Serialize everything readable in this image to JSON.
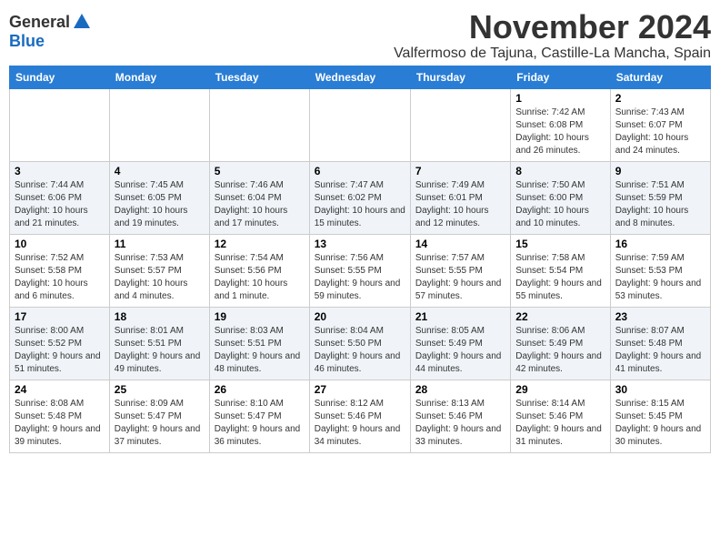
{
  "header": {
    "logo_general": "General",
    "logo_blue": "Blue",
    "month_title": "November 2024",
    "subtitle": "Valfermoso de Tajuna, Castille-La Mancha, Spain"
  },
  "days_of_week": [
    "Sunday",
    "Monday",
    "Tuesday",
    "Wednesday",
    "Thursday",
    "Friday",
    "Saturday"
  ],
  "weeks": [
    [
      {
        "day": "",
        "sunrise": "",
        "sunset": "",
        "daylight": ""
      },
      {
        "day": "",
        "sunrise": "",
        "sunset": "",
        "daylight": ""
      },
      {
        "day": "",
        "sunrise": "",
        "sunset": "",
        "daylight": ""
      },
      {
        "day": "",
        "sunrise": "",
        "sunset": "",
        "daylight": ""
      },
      {
        "day": "",
        "sunrise": "",
        "sunset": "",
        "daylight": ""
      },
      {
        "day": "1",
        "sunrise": "Sunrise: 7:42 AM",
        "sunset": "Sunset: 6:08 PM",
        "daylight": "Daylight: 10 hours and 26 minutes."
      },
      {
        "day": "2",
        "sunrise": "Sunrise: 7:43 AM",
        "sunset": "Sunset: 6:07 PM",
        "daylight": "Daylight: 10 hours and 24 minutes."
      }
    ],
    [
      {
        "day": "3",
        "sunrise": "Sunrise: 7:44 AM",
        "sunset": "Sunset: 6:06 PM",
        "daylight": "Daylight: 10 hours and 21 minutes."
      },
      {
        "day": "4",
        "sunrise": "Sunrise: 7:45 AM",
        "sunset": "Sunset: 6:05 PM",
        "daylight": "Daylight: 10 hours and 19 minutes."
      },
      {
        "day": "5",
        "sunrise": "Sunrise: 7:46 AM",
        "sunset": "Sunset: 6:04 PM",
        "daylight": "Daylight: 10 hours and 17 minutes."
      },
      {
        "day": "6",
        "sunrise": "Sunrise: 7:47 AM",
        "sunset": "Sunset: 6:02 PM",
        "daylight": "Daylight: 10 hours and 15 minutes."
      },
      {
        "day": "7",
        "sunrise": "Sunrise: 7:49 AM",
        "sunset": "Sunset: 6:01 PM",
        "daylight": "Daylight: 10 hours and 12 minutes."
      },
      {
        "day": "8",
        "sunrise": "Sunrise: 7:50 AM",
        "sunset": "Sunset: 6:00 PM",
        "daylight": "Daylight: 10 hours and 10 minutes."
      },
      {
        "day": "9",
        "sunrise": "Sunrise: 7:51 AM",
        "sunset": "Sunset: 5:59 PM",
        "daylight": "Daylight: 10 hours and 8 minutes."
      }
    ],
    [
      {
        "day": "10",
        "sunrise": "Sunrise: 7:52 AM",
        "sunset": "Sunset: 5:58 PM",
        "daylight": "Daylight: 10 hours and 6 minutes."
      },
      {
        "day": "11",
        "sunrise": "Sunrise: 7:53 AM",
        "sunset": "Sunset: 5:57 PM",
        "daylight": "Daylight: 10 hours and 4 minutes."
      },
      {
        "day": "12",
        "sunrise": "Sunrise: 7:54 AM",
        "sunset": "Sunset: 5:56 PM",
        "daylight": "Daylight: 10 hours and 1 minute."
      },
      {
        "day": "13",
        "sunrise": "Sunrise: 7:56 AM",
        "sunset": "Sunset: 5:55 PM",
        "daylight": "Daylight: 9 hours and 59 minutes."
      },
      {
        "day": "14",
        "sunrise": "Sunrise: 7:57 AM",
        "sunset": "Sunset: 5:55 PM",
        "daylight": "Daylight: 9 hours and 57 minutes."
      },
      {
        "day": "15",
        "sunrise": "Sunrise: 7:58 AM",
        "sunset": "Sunset: 5:54 PM",
        "daylight": "Daylight: 9 hours and 55 minutes."
      },
      {
        "day": "16",
        "sunrise": "Sunrise: 7:59 AM",
        "sunset": "Sunset: 5:53 PM",
        "daylight": "Daylight: 9 hours and 53 minutes."
      }
    ],
    [
      {
        "day": "17",
        "sunrise": "Sunrise: 8:00 AM",
        "sunset": "Sunset: 5:52 PM",
        "daylight": "Daylight: 9 hours and 51 minutes."
      },
      {
        "day": "18",
        "sunrise": "Sunrise: 8:01 AM",
        "sunset": "Sunset: 5:51 PM",
        "daylight": "Daylight: 9 hours and 49 minutes."
      },
      {
        "day": "19",
        "sunrise": "Sunrise: 8:03 AM",
        "sunset": "Sunset: 5:51 PM",
        "daylight": "Daylight: 9 hours and 48 minutes."
      },
      {
        "day": "20",
        "sunrise": "Sunrise: 8:04 AM",
        "sunset": "Sunset: 5:50 PM",
        "daylight": "Daylight: 9 hours and 46 minutes."
      },
      {
        "day": "21",
        "sunrise": "Sunrise: 8:05 AM",
        "sunset": "Sunset: 5:49 PM",
        "daylight": "Daylight: 9 hours and 44 minutes."
      },
      {
        "day": "22",
        "sunrise": "Sunrise: 8:06 AM",
        "sunset": "Sunset: 5:49 PM",
        "daylight": "Daylight: 9 hours and 42 minutes."
      },
      {
        "day": "23",
        "sunrise": "Sunrise: 8:07 AM",
        "sunset": "Sunset: 5:48 PM",
        "daylight": "Daylight: 9 hours and 41 minutes."
      }
    ],
    [
      {
        "day": "24",
        "sunrise": "Sunrise: 8:08 AM",
        "sunset": "Sunset: 5:48 PM",
        "daylight": "Daylight: 9 hours and 39 minutes."
      },
      {
        "day": "25",
        "sunrise": "Sunrise: 8:09 AM",
        "sunset": "Sunset: 5:47 PM",
        "daylight": "Daylight: 9 hours and 37 minutes."
      },
      {
        "day": "26",
        "sunrise": "Sunrise: 8:10 AM",
        "sunset": "Sunset: 5:47 PM",
        "daylight": "Daylight: 9 hours and 36 minutes."
      },
      {
        "day": "27",
        "sunrise": "Sunrise: 8:12 AM",
        "sunset": "Sunset: 5:46 PM",
        "daylight": "Daylight: 9 hours and 34 minutes."
      },
      {
        "day": "28",
        "sunrise": "Sunrise: 8:13 AM",
        "sunset": "Sunset: 5:46 PM",
        "daylight": "Daylight: 9 hours and 33 minutes."
      },
      {
        "day": "29",
        "sunrise": "Sunrise: 8:14 AM",
        "sunset": "Sunset: 5:46 PM",
        "daylight": "Daylight: 9 hours and 31 minutes."
      },
      {
        "day": "30",
        "sunrise": "Sunrise: 8:15 AM",
        "sunset": "Sunset: 5:45 PM",
        "daylight": "Daylight: 9 hours and 30 minutes."
      }
    ]
  ]
}
